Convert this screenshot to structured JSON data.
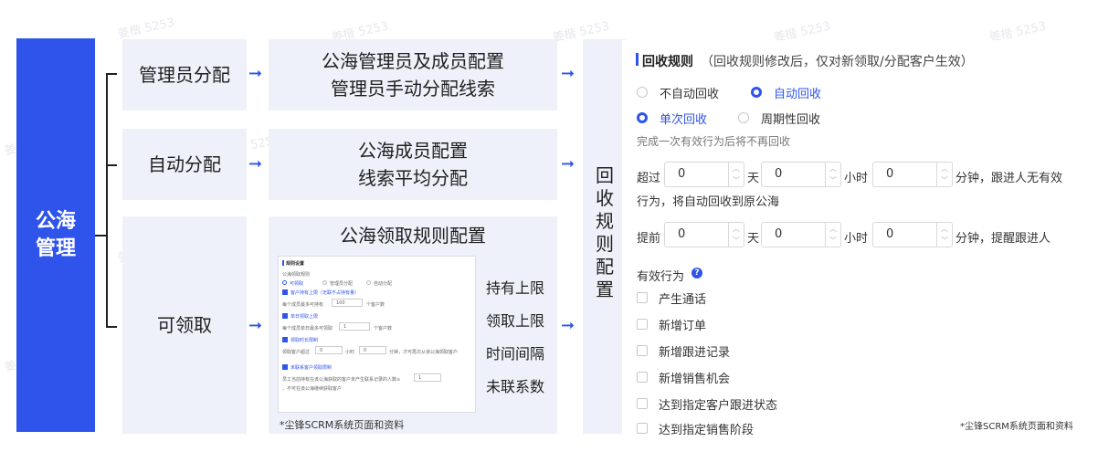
{
  "root": {
    "line1": "公海",
    "line2": "管理"
  },
  "branches": [
    {
      "label": "管理员分配",
      "detail_line1": "公海管理员及成员配置",
      "detail_line2": "管理员手动分配线索"
    },
    {
      "label": "自动分配",
      "detail_line1": "公海成员配置",
      "detail_line2": "线索平均分配"
    },
    {
      "label": "可领取",
      "detail_title": "公海领取规则配置",
      "rule_items": [
        "持有上限",
        "领取上限",
        "时间间隔",
        "未联系数"
      ],
      "credit": "*尘锋SCRM系统页面和资料",
      "mini": {
        "title": "规则设置",
        "row1": "公海领取规则",
        "opt1": "可领取",
        "opt2": "管理员分配",
        "opt3": "自动分配",
        "c1": "客户持有上限（无联不占持有量）",
        "c1_text": "每个成员最多可持有",
        "c1_val": "100",
        "c1_unit": "个客户数",
        "c2": "单日领取上限",
        "c2_text": "每个成员单日最多可领取",
        "c2_val": "1",
        "c2_unit": "个客户数",
        "c3": "领取时长限制",
        "c3_text": "领取客户超过",
        "c3_val1": "0",
        "c3_u1": "小时",
        "c3_val2": "0",
        "c3_u2": "分钟，才可再次从该公海领取客户",
        "c4": "未联系客户领取限制",
        "c4_text": "员工当前持有在该公海获取的客户未产生联系记录的人数≥",
        "c4_val": "1",
        "c4_text2": "，不可在该公海继续获取客户"
      }
    }
  ],
  "vertical_label": [
    "回",
    "收",
    "规",
    "则",
    "配",
    "置"
  ],
  "panel": {
    "title": "回收规则",
    "title_note": "（回收规则修改后，仅对新领取/分配客户生效）",
    "opt_no_auto": "不自动回收",
    "opt_auto": "自动回收",
    "opt_single": "单次回收",
    "opt_periodic": "周期性回收",
    "single_note": "完成一次有效行为后将不再回收",
    "exceed_prefix": "超过",
    "exceed_day": "0",
    "unit_day": "天",
    "exceed_hour": "0",
    "unit_hour": "小时",
    "exceed_min": "0",
    "unit_min": "分钟，跟进人无有效",
    "exceed_tail": "行为，将自动回收到原公海",
    "advance_prefix": "提前",
    "adv_day": "0",
    "adv_hour": "0",
    "adv_min": "0",
    "advance_tail": "分钟，提醒跟进人",
    "valid_label": "有效行为",
    "behaviors": [
      "产生通话",
      "新增订单",
      "新增跟进记录",
      "新增销售机会",
      "达到指定客户跟进状态",
      "达到指定销售阶段"
    ],
    "credit": "*尘锋SCRM系统页面和资料"
  },
  "watermark": "姜楷 5253",
  "colors": {
    "accent": "#2f54eb",
    "box_bg": "#eef1f9"
  }
}
